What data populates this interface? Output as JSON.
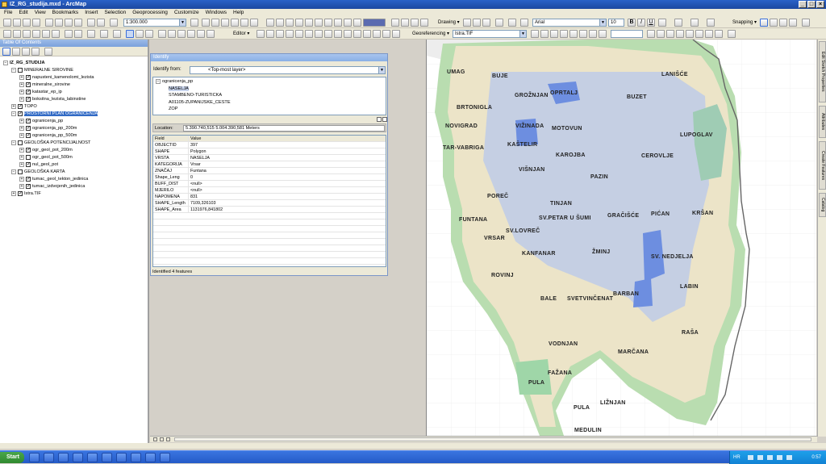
{
  "window": {
    "title": "IZ_RG_studija.mxd - ArcMap"
  },
  "menu": [
    "File",
    "Edit",
    "View",
    "Bookmarks",
    "Insert",
    "Selection",
    "Geoprocessing",
    "Customize",
    "Windows",
    "Help"
  ],
  "toolbar": {
    "scale": "1:300.000",
    "drawing_label": "Drawing ▾",
    "font": "Arial",
    "font_size": "10",
    "snapping_label": "Snapping ▾",
    "editor_label": "Editor ▾",
    "georeferencing_label": "Georeferencing ▾",
    "georef_layer": "Istra.TIF"
  },
  "toc": {
    "title": "Table Of Contents",
    "items": [
      {
        "label": "IZ_RG_STUDIJA",
        "level": 0,
        "expander": "−",
        "checked": null,
        "selected": false
      },
      {
        "label": "MINERALNE SIROVINE",
        "level": 1,
        "expander": "−",
        "checked": false,
        "selected": false
      },
      {
        "label": "napusteni_kamenolomi_lezista",
        "level": 2,
        "expander": "+",
        "checked": true,
        "selected": false
      },
      {
        "label": "mineralne_sirovine",
        "level": 2,
        "expander": "+",
        "checked": true,
        "selected": false
      },
      {
        "label": "katastar_ep_ip",
        "level": 2,
        "expander": "+",
        "checked": true,
        "selected": false
      },
      {
        "label": "boksitna_lezista_labinstine",
        "level": 2,
        "expander": "+",
        "checked": true,
        "selected": false
      },
      {
        "label": "TOPO",
        "level": 1,
        "expander": "+",
        "checked": true,
        "selected": false
      },
      {
        "label": "PROSTORNI PLAN OGRANIČENJA",
        "level": 1,
        "expander": "−",
        "checked": true,
        "selected": true
      },
      {
        "label": "ogranicenja_pp",
        "level": 2,
        "expander": "+",
        "checked": true,
        "selected": false
      },
      {
        "label": "ogranicenja_pp_200m",
        "level": 2,
        "expander": "+",
        "checked": true,
        "selected": false
      },
      {
        "label": "ogranicenja_pp_500m",
        "level": 2,
        "expander": "+",
        "checked": true,
        "selected": false
      },
      {
        "label": "GEOLOŠKA POTENCIJALNOST",
        "level": 1,
        "expander": "−",
        "checked": false,
        "selected": false
      },
      {
        "label": "ogr_geol_pot_200m",
        "level": 2,
        "expander": "+",
        "checked": true,
        "selected": false
      },
      {
        "label": "ogr_geol_pot_500m",
        "level": 2,
        "expander": "+",
        "checked": false,
        "selected": false
      },
      {
        "label": "nul_geol_pot",
        "level": 2,
        "expander": "+",
        "checked": true,
        "selected": false
      },
      {
        "label": "GEOLOŠKA KARTA",
        "level": 1,
        "expander": "−",
        "checked": false,
        "selected": false
      },
      {
        "label": "tumac_geol_tekton_jedinica",
        "level": 2,
        "expander": "+",
        "checked": true,
        "selected": false
      },
      {
        "label": "tumac_izdvojenih_jedinica",
        "level": 2,
        "expander": "+",
        "checked": true,
        "selected": false
      },
      {
        "label": "Istra.TIF",
        "level": 1,
        "expander": "+",
        "checked": true,
        "selected": false
      }
    ]
  },
  "identify": {
    "title": "Identify",
    "from_label": "Identify from:",
    "from_value": "<Top-most layer>",
    "tree": [
      {
        "label": "ogranicenja_pp",
        "level": 0,
        "selected": false
      },
      {
        "label": "NASELJA",
        "level": 1,
        "selected": true
      },
      {
        "label": "STAMBENO-TURISTICKA",
        "level": 1,
        "selected": false
      },
      {
        "label": "A01105-ZUPANIJSKE_CESTE",
        "level": 1,
        "selected": false
      },
      {
        "label": "ZOP",
        "level": 1,
        "selected": false
      }
    ],
    "location_label": "Location:",
    "location_value": "5.390.740,515  5.004.390,581 Meters",
    "col_field": "Field",
    "col_value": "Value",
    "rows": [
      [
        "OBJECTID",
        "397"
      ],
      [
        "SHAPE",
        "Polygon"
      ],
      [
        "VRSTA",
        "NASELJA"
      ],
      [
        "KATEGORIJA",
        "Vrsar"
      ],
      [
        "ZNAČAJ",
        "Funtana"
      ],
      [
        "Shape_Leng",
        "0"
      ],
      [
        "BUFF_DIST",
        "<null>"
      ],
      [
        "MJERILO",
        "<null>"
      ],
      [
        "NAPOMENA",
        "831"
      ],
      [
        "SHAPE_Length",
        "7109,326103"
      ],
      [
        "SHAPE_Area",
        "1131976,841802"
      ]
    ],
    "status": "Identified 4 features"
  },
  "map": {
    "towns": [
      "UMAG",
      "BUJE",
      "GROŽNJAN",
      "OPRTALJ",
      "LANIŠĆE",
      "BRTONIGLA",
      "BUZET",
      "NOVIGRAD",
      "VIŽINADA",
      "MOTOVUN",
      "LUPOGLAV",
      "TAR-VABRIGA",
      "KAŠTELIR",
      "KAROJBA",
      "CEROVLJE",
      "VIŠNJAN",
      "PAZIN",
      "POREČ",
      "TINJAN",
      "FUNTANA",
      "SV.PETAR U ŠUMI",
      "GRAČIŠĆE",
      "PIĆAN",
      "KRŠAN",
      "SV.LOVREČ",
      "VRSAR",
      "KANFANAR",
      "ŽMINJ",
      "SV. NEDJELJA",
      "ROVINJ",
      "LABIN",
      "BALE",
      "SVETVINČENAT",
      "BARBAN",
      "RAŠA",
      "VODNJAN",
      "MARČANA",
      "FAŽANA",
      "PULA",
      "LIŽNJAN",
      "PULA",
      "MEDULIN"
    ]
  },
  "dock_tabs": [
    "Edit Sketch Properties",
    "Attributes",
    "Create Features",
    "Catalog"
  ],
  "taskbar": {
    "start_label": "Start",
    "lang": "HR",
    "time": "0:57"
  }
}
